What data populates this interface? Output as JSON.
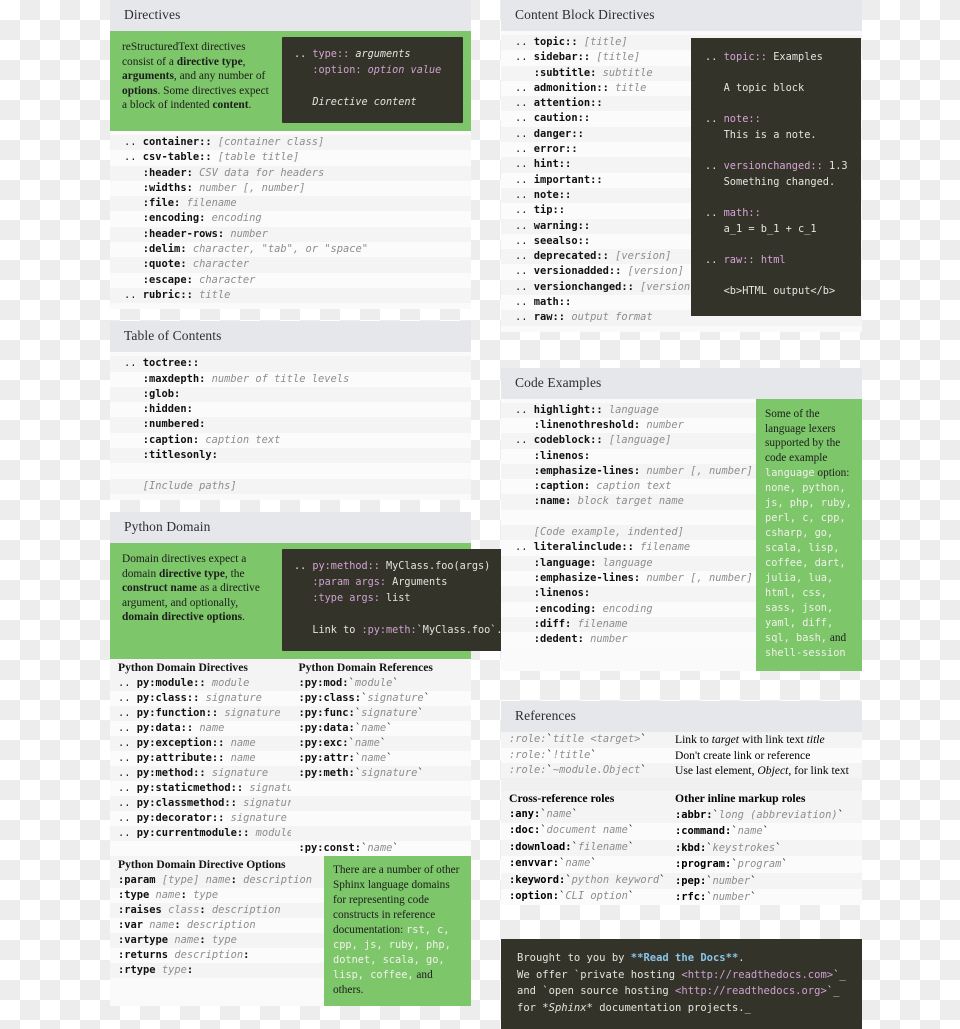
{
  "sections": {
    "directives": {
      "title": "Directives",
      "intro_html": "reStructuredText directives consist of a <b>directive type</b>, <b>arguments</b>, and any number of <b>options</b>. Some directives expect a block of indented <b>content</b>.",
      "intro_code_html": ".. <span class=\"m-dir\">type::</span> <span class=\"m-it\">arguments</span>\n   <span class=\"m-str\">:option:</span> <span class=\"m-str m-it\">option value</span>\n\n   <span class=\"m-it\">Directive content</span>",
      "rows_html": [
        ".. <span class=\"kw\">container::</span> <span class=\"arg\">[container class]</span>",
        ".. <span class=\"kw\">csv-table::</span> <span class=\"arg\">[table title]</span>",
        "   <span class=\"kw\">:header:</span> <span class=\"arg\">CSV data for headers</span>",
        "   <span class=\"kw\">:widths:</span> <span class=\"arg\">number [, number]</span>",
        "   <span class=\"kw\">:file:</span> <span class=\"arg\">filename</span>",
        "   <span class=\"kw\">:encoding:</span> <span class=\"arg\">encoding</span>",
        "   <span class=\"kw\">:header-rows:</span> <span class=\"arg\">number</span>",
        "   <span class=\"kw\">:delim:</span> <span class=\"arg\">character, \"tab\", or \"space\"</span>",
        "   <span class=\"kw\">:quote:</span> <span class=\"arg\">character</span>",
        "   <span class=\"kw\">:escape:</span> <span class=\"arg\">character</span>",
        ".. <span class=\"kw\">rubric::</span> <span class=\"arg\">title</span>"
      ]
    },
    "toc": {
      "title": "Table of Contents",
      "rows_html": [
        ".. <span class=\"kw\">toctree::</span>",
        "   <span class=\"kw\">:maxdepth:</span> <span class=\"arg\">number of title levels</span>",
        "   <span class=\"kw\">:glob:</span>",
        "   <span class=\"kw\">:hidden:</span>",
        "   <span class=\"kw\">:numbered:</span>",
        "   <span class=\"kw\">:caption:</span> <span class=\"arg\">caption text</span>",
        "   <span class=\"kw\">:titlesonly:</span>",
        "",
        "   <span class=\"arg\">[Include paths]</span>"
      ]
    },
    "python_domain": {
      "title": "Python Domain",
      "intro_html": "Domain directives expect a domain <b>directive type</b>, the <b>construct name</b> as a directive argument, and optionally, <b>domain directive options</b>.",
      "intro_code_html": ".. <span class=\"m-dir\">py:method::</span> MyClass.foo(args)\n   <span class=\"m-str\">:param args:</span> Arguments\n   <span class=\"m-str\">:type args:</span> list\n\n   Link to <span class=\"m-str\">:py:meth:</span>`MyClass.foo`.",
      "directives_header": "Python Domain Directives",
      "references_header": "Python Domain References",
      "directives_html": [
        ".. <span class=\"kw\">py:module::</span> <span class=\"arg\">module</span>",
        ".. <span class=\"kw\">py:class::</span> <span class=\"arg\">signature</span>",
        ".. <span class=\"kw\">py:function::</span> <span class=\"arg\">signature</span>",
        ".. <span class=\"kw\">py:data::</span> <span class=\"arg\">name</span>",
        ".. <span class=\"kw\">py:exception::</span> <span class=\"arg\">name</span>",
        ".. <span class=\"kw\">py:attribute::</span> <span class=\"arg\">name</span>",
        ".. <span class=\"kw\">py:method::</span> <span class=\"arg\">signature</span>",
        ".. <span class=\"kw\">py:staticmethod::</span> <span class=\"arg\">signature</span>",
        ".. <span class=\"kw\">py:classmethod::</span> <span class=\"arg\">signature</span>",
        ".. <span class=\"kw\">py:decorator::</span> <span class=\"arg\">signature</span>",
        ".. <span class=\"kw\">py:currentmodule::</span> <span class=\"arg\">module</span>",
        ""
      ],
      "references_html": [
        "<span class=\"kw\">:py:mod:</span>`<span class=\"arg\">module</span>`",
        "<span class=\"kw\">:py:class:</span>`<span class=\"arg\">signature</span>`",
        "<span class=\"kw\">:py:func:</span>`<span class=\"arg\">signature</span>`",
        "<span class=\"kw\">:py:data:</span>`<span class=\"arg\">name</span>`",
        "<span class=\"kw\">:py:exc:</span>`<span class=\"arg\">name</span>`",
        "<span class=\"kw\">:py:attr:</span>`<span class=\"arg\">name</span>`",
        "<span class=\"kw\">:py:meth:</span>`<span class=\"arg\">signature</span>`",
        "",
        "",
        "",
        "",
        "<span class=\"kw\">:py:const:</span>`<span class=\"arg\">name</span>`"
      ],
      "options_header": "Python Domain Directive Options",
      "options_html": [
        "<span class=\"kw\">:param</span> <span class=\"arg\">[type] name</span><span class=\"kw\">:</span> <span class=\"arg\">description</span>",
        "<span class=\"kw\">:type</span> <span class=\"arg\">name</span><span class=\"kw\">:</span> <span class=\"arg\">type</span>",
        "<span class=\"kw\">:raises</span> <span class=\"arg\">class</span><span class=\"kw\">:</span> <span class=\"arg\">description</span>",
        "<span class=\"kw\">:var</span> <span class=\"arg\">name</span><span class=\"kw\">:</span> <span class=\"arg\">description</span>",
        "<span class=\"kw\">:vartype</span> <span class=\"arg\">name</span><span class=\"kw\">:</span> <span class=\"arg\">type</span>",
        "<span class=\"kw\">:returns</span> <span class=\"arg\">description</span><span class=\"kw\">:</span>",
        "<span class=\"kw\">:rtype</span> <span class=\"arg\">type</span><span class=\"kw\">:</span>"
      ],
      "other_domains_html": "There are a number of other Sphinx language domains for representing code constructs in reference documentation: <span class=\"mono\">rst, c, cpp, js, ruby, php, dotnet, scala, go, lisp, coffee,</span> and others."
    },
    "content_block": {
      "title": "Content Block Directives",
      "rows_html": [
        ".. <span class=\"kw\">topic::</span> <span class=\"arg\">[title]</span>",
        ".. <span class=\"kw\">sidebar::</span> <span class=\"arg\">[title]</span>",
        "   <span class=\"kw\">:subtitle:</span> <span class=\"arg\">subtitle</span>",
        ".. <span class=\"kw\">admonition::</span> <span class=\"arg\">title</span>",
        ".. <span class=\"kw\">attention::</span>",
        ".. <span class=\"kw\">caution::</span>",
        ".. <span class=\"kw\">danger::</span>",
        ".. <span class=\"kw\">error::</span>",
        ".. <span class=\"kw\">hint::</span>",
        ".. <span class=\"kw\">important::</span>",
        ".. <span class=\"kw\">note::</span>",
        ".. <span class=\"kw\">tip::</span>",
        ".. <span class=\"kw\">warning::</span>",
        ".. <span class=\"kw\">seealso::</span>",
        ".. <span class=\"kw\">deprecated::</span> <span class=\"arg\">[version]</span>",
        ".. <span class=\"kw\">versionadded::</span> <span class=\"arg\">[version]</span>",
        ".. <span class=\"kw\">versionchanged::</span> <span class=\"arg\">[version]</span>",
        ".. <span class=\"kw\">math::</span>",
        ".. <span class=\"kw\">raw::</span> <span class=\"arg\">output format</span>"
      ],
      "example_code_html": ".. <span class=\"m-dir\">topic::</span> Examples\n\n   A topic block\n\n.. <span class=\"m-dir\">note::</span>\n   This is a note.\n\n.. <span class=\"m-dir\">versionchanged::</span> 1.3\n   Something changed.\n\n.. <span class=\"m-dir\">math::</span>\n   a_1 = b_1 + c_1\n\n.. <span class=\"m-dir\">raw::</span> <span class=\"m-dir\">html</span>\n\n   &lt;b&gt;HTML output&lt;/b&gt;"
    },
    "code_examples": {
      "title": "Code Examples",
      "rows_html": [
        ".. <span class=\"kw\">highlight::</span> <span class=\"arg\">language</span>",
        "   <span class=\"kw\">:linenothreshold:</span> <span class=\"arg\">number</span>",
        ".. <span class=\"kw\">codeblock::</span> <span class=\"arg\">[language]</span>",
        "   <span class=\"kw\">:linenos:</span>",
        "   <span class=\"kw\">:emphasize-lines:</span> <span class=\"arg\">number [, number]</span>",
        "   <span class=\"kw\">:caption:</span> <span class=\"arg\">caption text</span>",
        "   <span class=\"kw\">:name:</span> <span class=\"arg\">block target name</span>",
        "",
        "   <span class=\"arg\">[Code example, indented]</span>",
        ".. <span class=\"kw\">literalinclude::</span> <span class=\"arg\">filename</span>",
        "   <span class=\"kw\">:language:</span> <span class=\"arg\">language</span>",
        "   <span class=\"kw\">:emphasize-lines:</span> <span class=\"arg\">number [, number]</span>",
        "   <span class=\"kw\">:linenos:</span>",
        "   <span class=\"kw\">:encoding:</span> <span class=\"arg\">encoding</span>",
        "   <span class=\"kw\">:diff:</span> <span class=\"arg\">filename</span>",
        "   <span class=\"kw\">:dedent:</span> <span class=\"arg\">number</span>"
      ],
      "sidepanel_html": "Some of the language lexers supported by the code example <span class=\"mono\">language</span> option: <span class=\"mono\">none, python, js, php, ruby, perl, c, cpp, csharp, go, scala, lisp, coffee, dart, julia, lua, html, css, sass, json, yaml, diff, sql, bash,</span> and <span class=\"mono\">shell-session</span>"
    },
    "references": {
      "title": "References",
      "rows": [
        {
          "c1_html": "<span class=\"mi\">:role:</span>`<span class=\"mi\">title &lt;target&gt;</span>`",
          "c2_html": "Link to <i>target</i> with link text <i>title</i>"
        },
        {
          "c1_html": "<span class=\"mi\">:role:</span>`<span class=\"mi\">!title</span>`",
          "c2_html": "Don't create link or reference"
        },
        {
          "c1_html": "<span class=\"mi\">:role:</span>`<span class=\"mi\">~module.Object</span>`",
          "c2_html": "Use last element, <i>Object</i>, for link text"
        }
      ],
      "crossref_header": "Cross-reference roles",
      "inline_header": "Other inline markup roles",
      "crossref_html": [
        "<span class=\"mb\">:any:</span>`<span class=\"mi\">name</span>`",
        "<span class=\"mb\">:doc:</span>`<span class=\"mi\">document name</span>`",
        "<span class=\"mb\">:download:</span>`<span class=\"mi\">filename</span>`",
        "<span class=\"mb\">:envvar:</span>`<span class=\"mi\">name</span>`",
        "<span class=\"mb\">:keyword:</span>`<span class=\"mi\">python keyword</span>`",
        "<span class=\"mb\">:option:</span>`<span class=\"mi\">CLI option</span>`"
      ],
      "inline_html": [
        "<span class=\"mb\">:abbr:</span>`<span class=\"mi\">long (abbreviation)</span>`",
        "<span class=\"mb\">:command:</span>`<span class=\"mi\">name</span>`",
        "<span class=\"mb\">:kbd:</span>`<span class=\"mi\">keystrokes</span>`",
        "<span class=\"mb\">:program:</span>`<span class=\"mi\">program</span>`",
        "<span class=\"mb\">:pep:</span>`<span class=\"mi\">number</span>`",
        "<span class=\"mb\">:rfc:</span>`<span class=\"mi\">number</span>`"
      ]
    },
    "footer": {
      "code_html": "Brought to you by <span class=\"f-b\">**Read the Docs**</span>.\nWe offer `private hosting <span class=\"f-p\">&lt;http://readthedocs.com&gt;</span>`_\nand `open source hosting <span class=\"f-p\">&lt;http://readthedocs.org&gt;</span>`_\nfor <span class=\"f-i\">*Sphinx*</span> documentation projects._"
    }
  },
  "colors": {
    "green_panel": "#7dc66a",
    "dark_code": "#33332a",
    "card_header": "#e6e7eb",
    "row_odd": "#f4f4f4",
    "row_even": "#fbfbfb"
  }
}
